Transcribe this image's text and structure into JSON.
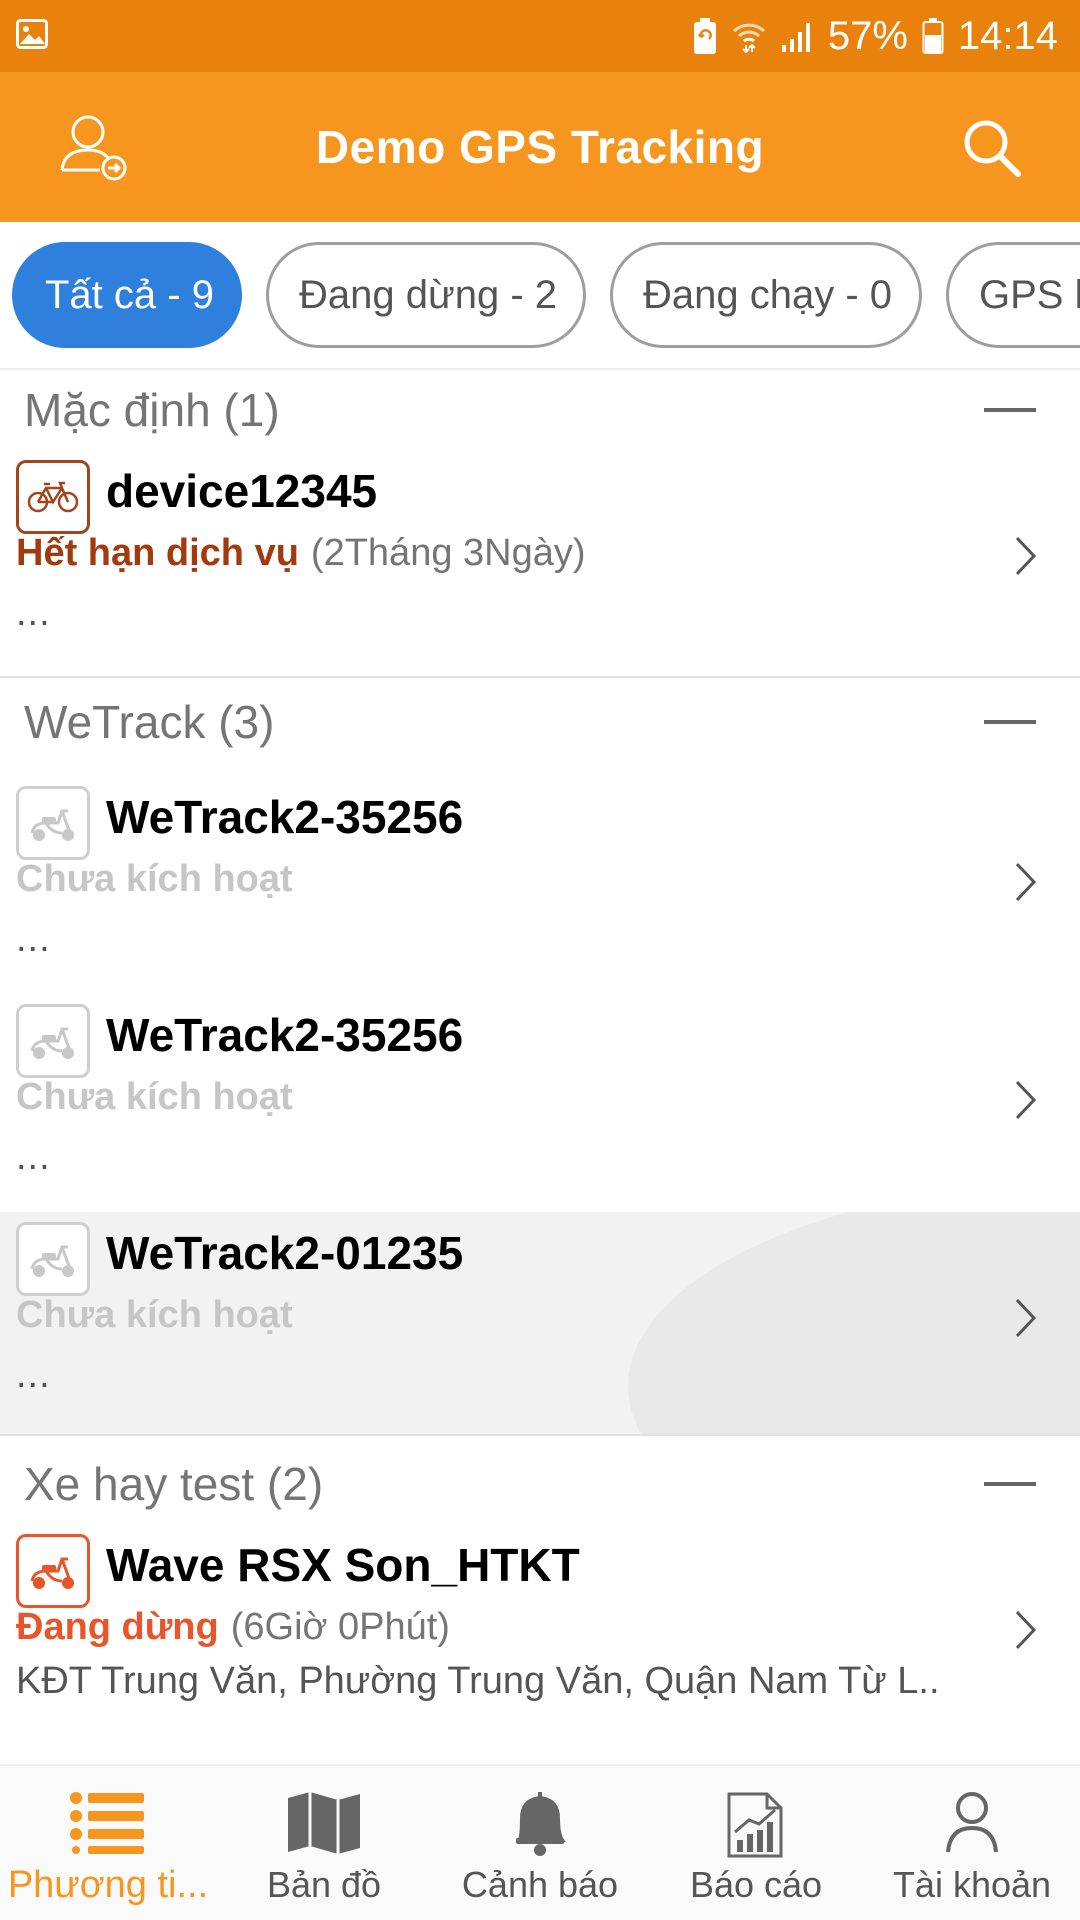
{
  "status_bar": {
    "battery_percent": "57%",
    "time": "14:14"
  },
  "app_bar": {
    "title": "Demo GPS Tracking"
  },
  "filters": [
    {
      "label": "Tất cả - 9",
      "active": true
    },
    {
      "label": "Đang dừng - 2",
      "active": false
    },
    {
      "label": "Đang chạy - 0",
      "active": false
    },
    {
      "label": "GPS k",
      "active": false
    }
  ],
  "groups": [
    {
      "title": "Mặc định (1)",
      "items": [
        {
          "name": "device12345",
          "icon": "bicycle-icon",
          "status": "Hết hạn dịch vụ",
          "duration": "(2Tháng 3Ngày)",
          "address": "..."
        }
      ]
    },
    {
      "title": "WeTrack (3)",
      "items": [
        {
          "name": "WeTrack2-35256",
          "icon": "scooter-icon",
          "status": "Chưa kích hoạt",
          "address": "..."
        },
        {
          "name": "WeTrack2-35256",
          "icon": "scooter-icon",
          "status": "Chưa kích hoạt",
          "address": "..."
        },
        {
          "name": "WeTrack2-01235",
          "icon": "scooter-icon",
          "status": "Chưa kích hoạt",
          "address": "..."
        }
      ]
    },
    {
      "title": "Xe hay test (2)",
      "items": [
        {
          "name": "Wave RSX Son_HTKT",
          "icon": "scooter-icon",
          "status": "Đang dừng",
          "duration": "(6Giờ 0Phút)",
          "address": "KĐT Trung Văn, Phường Trung Văn, Quận Nam Từ L.."
        }
      ]
    }
  ],
  "bottom_nav": [
    {
      "label": "Phương ti...",
      "icon": "list-icon",
      "active": true
    },
    {
      "label": "Bản đồ",
      "icon": "map-icon",
      "active": false
    },
    {
      "label": "Cảnh báo",
      "icon": "bell-icon",
      "active": false
    },
    {
      "label": "Báo cáo",
      "icon": "report-icon",
      "active": false
    },
    {
      "label": "Tài khoản",
      "icon": "account-icon",
      "active": false
    }
  ],
  "colors": {
    "status_bar": "#e8820c",
    "app_bar": "#f7961e",
    "chip_active": "#2f80dc",
    "expired": "#a23a0e",
    "stopped": "#e8552a",
    "inactive": "#c6c6c6"
  }
}
